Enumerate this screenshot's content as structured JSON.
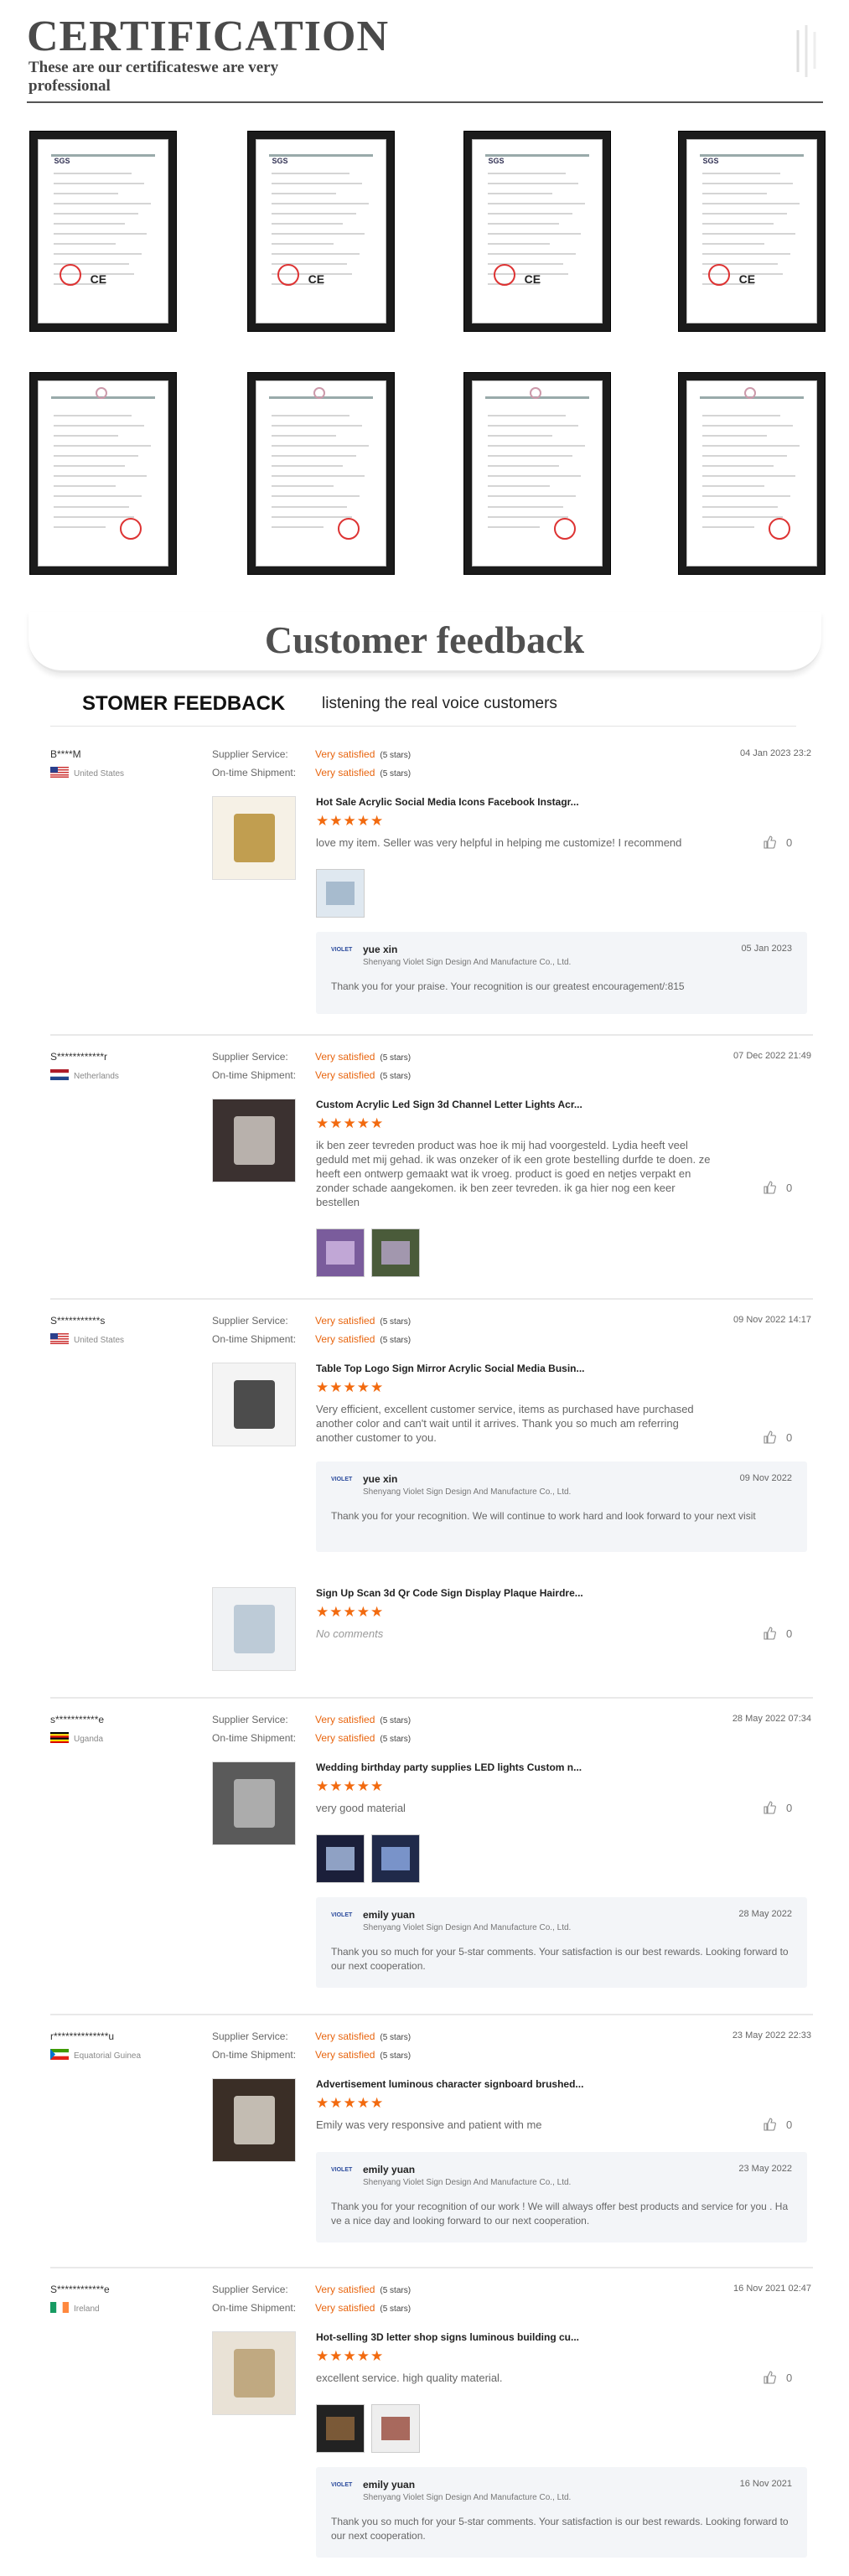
{
  "certification": {
    "title": "CERTIFICATION",
    "subtitle": "These are our certificateswe are very professional"
  },
  "feedback": {
    "banner_title": "Customer feedback",
    "header_left": "STOMER FEEDBACK",
    "header_right": "listening the real voice customers",
    "labels": {
      "supplier": "Supplier Service:",
      "shipment": "On-time Shipment:",
      "rating_text": "Very satisfied",
      "stars_text": "(5 stars)",
      "no_comments": "No comments"
    },
    "seller_company": "Shenyang Violet Sign Design And Manufacture Co., Ltd.",
    "reviews": [
      {
        "buyer": "B****M",
        "country": "United States",
        "date": "04 Jan 2023 23:2",
        "products": [
          {
            "title": "Hot Sale Acrylic Social Media Icons Facebook Instagr...",
            "comment": "love my item. Seller was very helpful in helping me customize! I recommend",
            "likes": "0",
            "reply": {
              "name": "yue xin",
              "date": "05 Jan 2023",
              "text": "Thank you for your praise. Your recognition is our greatest encouragement/:815"
            }
          }
        ]
      },
      {
        "buyer": "S************r",
        "country": "Netherlands",
        "date": "07 Dec 2022 21:49",
        "products": [
          {
            "title": "Custom Acrylic Led Sign 3d Channel Letter Lights Acr...",
            "comment": "ik ben zeer tevreden product was hoe ik mij had voorgesteld. Lydia heeft veel geduld met mij gehad. ik was onzeker of ik een grote bestelling durfde te doen. ze heeft een ontwerp gemaakt wat ik vroeg. product is goed en netjes verpakt en zonder schade aangekomen. ik ben zeer tevreden. ik ga hier nog een keer bestellen",
            "likes": "0"
          }
        ]
      },
      {
        "buyer": "S***********s",
        "country": "United States",
        "date": "09 Nov 2022 14:17",
        "products": [
          {
            "title": "Table Top Logo Sign Mirror Acrylic Social Media Busin...",
            "comment": "Very efficient, excellent customer service, items as purchased have purchased another color and can't wait until it arrives.  Thank you so much am referring another customer to you.",
            "likes": "0",
            "reply": {
              "name": "yue xin",
              "date": "09 Nov 2022",
              "text": "Thank you for your recognition. We will continue to work hard and look forward to your next visit"
            }
          },
          {
            "title": "Sign Up Scan 3d Qr Code Sign Display Plaque Hairdre...",
            "comment": "",
            "likes": "0"
          }
        ]
      },
      {
        "buyer": "s***********e",
        "country": "Uganda",
        "date": "28 May 2022 07:34",
        "products": [
          {
            "title": "Wedding birthday party supplies LED lights Custom n...",
            "comment": "very good material",
            "likes": "0",
            "reply": {
              "name": "emily yuan",
              "date": "28 May 2022",
              "text": "Thank you so much for your 5-star comments. Your satisfaction is our best rewards. Looking forward to our next cooperation."
            }
          }
        ]
      },
      {
        "buyer": "r**************u",
        "country": "Equatorial Guinea",
        "date": "23 May 2022 22:33",
        "products": [
          {
            "title": "Advertisement luminous character signboard brushed...",
            "comment": "Emily was very responsive and patient with me",
            "likes": "0",
            "reply": {
              "name": "emily yuan",
              "date": "23 May 2022",
              "text": "Thank you for your recognition of our work ! We will always offer best products and service for you . Have a nice day and looking forward to our next cooperation."
            }
          }
        ]
      },
      {
        "buyer": "S************e",
        "country": "Ireland",
        "date": "16 Nov 2021 02:47",
        "products": [
          {
            "title": "Hot-selling 3D letter shop signs luminous building cu...",
            "comment": "excellent service. high quality material.",
            "likes": "0",
            "reply": {
              "name": "emily yuan",
              "date": "16 Nov 2021",
              "text": "Thank you so much for your 5-star comments. Your satisfaction is our best rewards. Looking forward to our next cooperation."
            }
          }
        ]
      }
    ]
  },
  "colors": {
    "accent": "#e8650f",
    "stars": "#f26a0f"
  }
}
